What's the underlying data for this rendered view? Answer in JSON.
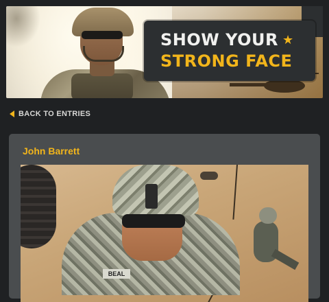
{
  "header": {
    "headline_line1": "SHOW YOUR",
    "headline_star": "★",
    "headline_line2": "STRONG FACE"
  },
  "nav": {
    "back_label": "BACK TO ENTRIES"
  },
  "entry": {
    "name": "John Barrett",
    "photo_nametag": "BEAL"
  },
  "colors": {
    "accent": "#f2b51b",
    "background": "#1f2123",
    "card": "#4a4d4f",
    "callout": "#2c2f31"
  }
}
